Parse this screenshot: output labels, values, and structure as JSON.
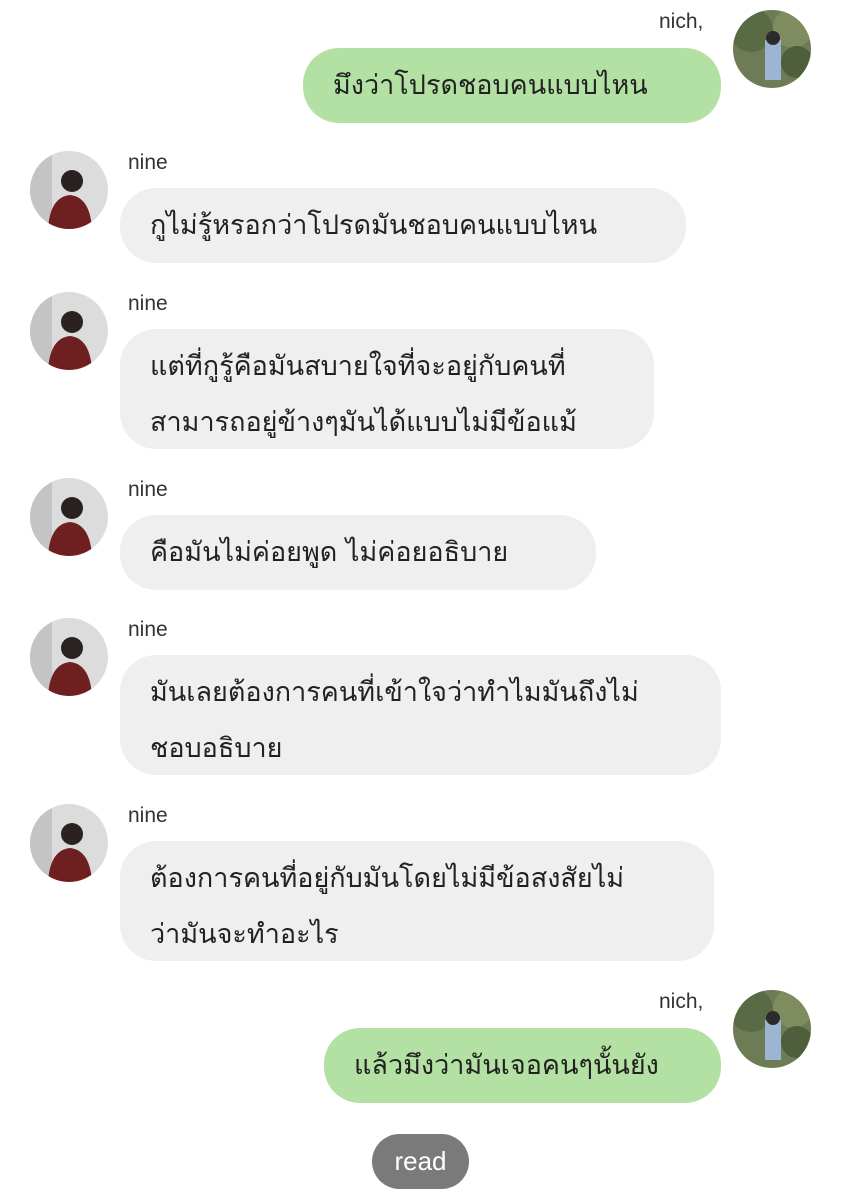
{
  "messages": [
    {
      "sender": "nich,",
      "lines": [
        "มึงว่าโปรดชอบคนแบบไหน"
      ]
    },
    {
      "sender": "nine",
      "lines": [
        "กูไม่รู้หรอกว่าโปรดมันชอบคนแบบไหน"
      ]
    },
    {
      "sender": "nine",
      "lines": [
        "แต่ที่กูรู้คือมันสบายใจที่จะอยู่กับคนที่",
        "สามารถอยู่ข้างๆมันได้แบบไม่มีข้อแม้"
      ]
    },
    {
      "sender": "nine",
      "lines": [
        "คือมันไม่ค่อยพูด ไม่ค่อยอธิบาย"
      ]
    },
    {
      "sender": "nine",
      "lines": [
        "มันเลยต้องการคนที่เข้าใจว่าทำไมมันถึงไม่",
        "ชอบอธิบาย"
      ]
    },
    {
      "sender": "nine",
      "lines": [
        "ต้องการคนที่อยู่กับมันโดยไม่มีข้อสงสัยไม่",
        "ว่ามันจะทำอะไร"
      ]
    },
    {
      "sender": "nich,",
      "lines": [
        "แล้วมึงว่ามันเจอคนๆนั้นยัง"
      ]
    }
  ],
  "read_label": "read",
  "colors": {
    "outgoing": "#b3e0a3",
    "incoming": "#efefef",
    "read_pill": "#7a7a7a"
  }
}
